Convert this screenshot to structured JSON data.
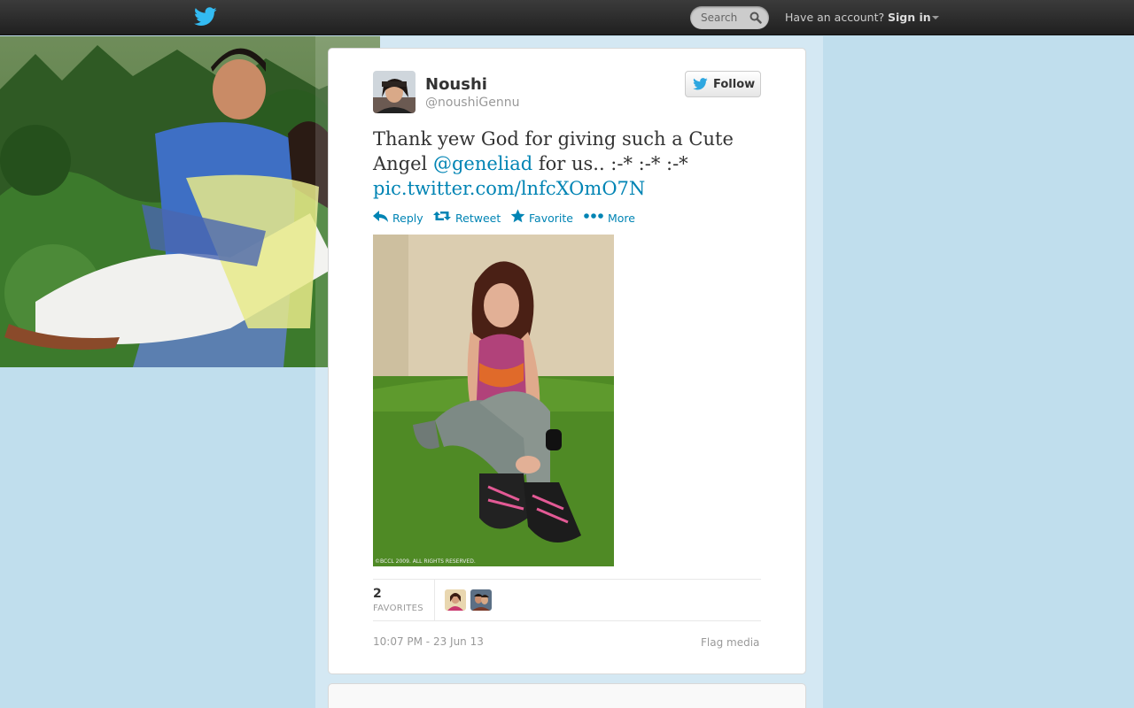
{
  "topbar": {
    "search_placeholder": "Search",
    "have_account": "Have an account?",
    "sign_in": "Sign in"
  },
  "tweet": {
    "full_name": "Noushi",
    "username": "@noushiGennu",
    "follow_label": "Follow",
    "text_before": "Thank yew God for giving such a Cute Angel ",
    "mention": "@geneliad",
    "text_after": " for us.. :-* :-* :-*",
    "pic_link": "pic.twitter.com/lnfcXOmO7N",
    "actions": {
      "reply": "Reply",
      "retweet": "Retweet",
      "favorite": "Favorite",
      "more": "More"
    },
    "media_caption": "©BCCL 2009. ALL RIGHTS RESERVED.",
    "favorites_count": "2",
    "favorites_label": "FAVORITES",
    "timestamp": "10:07 PM - 23 Jun 13",
    "flag_media": "Flag media"
  },
  "colors": {
    "link": "#0084b4",
    "background": "#c0deed",
    "topbar": "#2b2b2b"
  }
}
